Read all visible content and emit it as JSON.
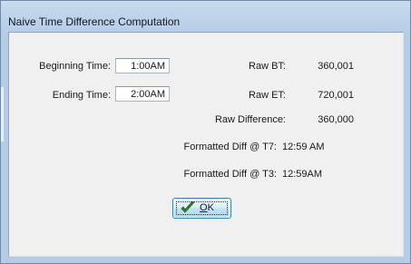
{
  "window": {
    "title": "Naive Time Difference Computation"
  },
  "form": {
    "beginning_label": "Beginning Time:",
    "beginning_value": "1:00AM",
    "ending_label": "Ending Time:",
    "ending_value": "2:00AM",
    "raw_bt_label": "Raw BT:",
    "raw_bt_value": "360,001",
    "raw_et_label": "Raw ET:",
    "raw_et_value": "720,001",
    "raw_diff_label": "Raw Difference:",
    "raw_diff_value": "360,000",
    "fmt_t7_label": "Formatted Diff @ T7:",
    "fmt_t7_value": "12:59 AM",
    "fmt_t3_label": "Formatted Diff @ T3:",
    "fmt_t3_value": "12:59AM"
  },
  "buttons": {
    "ok_mnemonic": "O",
    "ok_rest": "K",
    "ok_icon": "checkmark-icon"
  },
  "colors": {
    "checkmark": "#2f8a1e"
  }
}
